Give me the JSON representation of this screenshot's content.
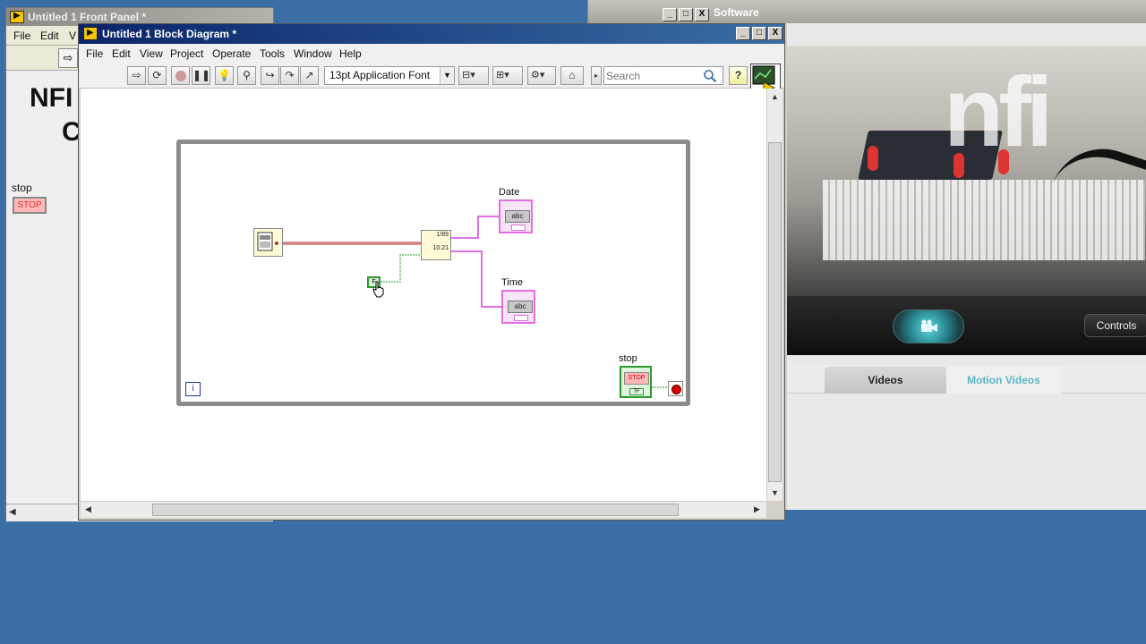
{
  "background_window": {
    "title_fragment": "Software",
    "controls_label": "Controls",
    "tabs": [
      {
        "label": "Videos",
        "active": true
      },
      {
        "label": "Motion Videos",
        "active": false
      }
    ],
    "brand_mark": "nfi"
  },
  "front_panel": {
    "title": "Untitled 1 Front Panel *",
    "menu": [
      "File",
      "Edit",
      "V"
    ],
    "heading_line1": "NFI",
    "heading_line2": "C",
    "stop_label": "stop",
    "stop_button_text": "STOP"
  },
  "block_diagram": {
    "title": "Untitled 1 Block Diagram *",
    "window_buttons": [
      "_",
      "□",
      "X"
    ],
    "menu": [
      "File",
      "Edit",
      "View",
      "Project",
      "Operate",
      "Tools",
      "Window",
      "Help"
    ],
    "font_select": "13pt Application Font",
    "search_placeholder": "Search",
    "help_label": "?",
    "nodes": {
      "date_label": "Date",
      "time_label": "Time",
      "indicator_text": "abc",
      "format_node_lines": [
        "1/89",
        "10:21"
      ],
      "false_constant": "F",
      "iteration_terminal": "i",
      "stop_label": "stop",
      "stop_button_text": "STOP",
      "stop_sub": "TF"
    }
  },
  "colors": {
    "desktop": "#3a6ea5",
    "string_wire": "#e070e0",
    "boolean_wire": "#2a9a2a",
    "timestamp_wire": "#b03030",
    "title_active": "#0a246a"
  }
}
